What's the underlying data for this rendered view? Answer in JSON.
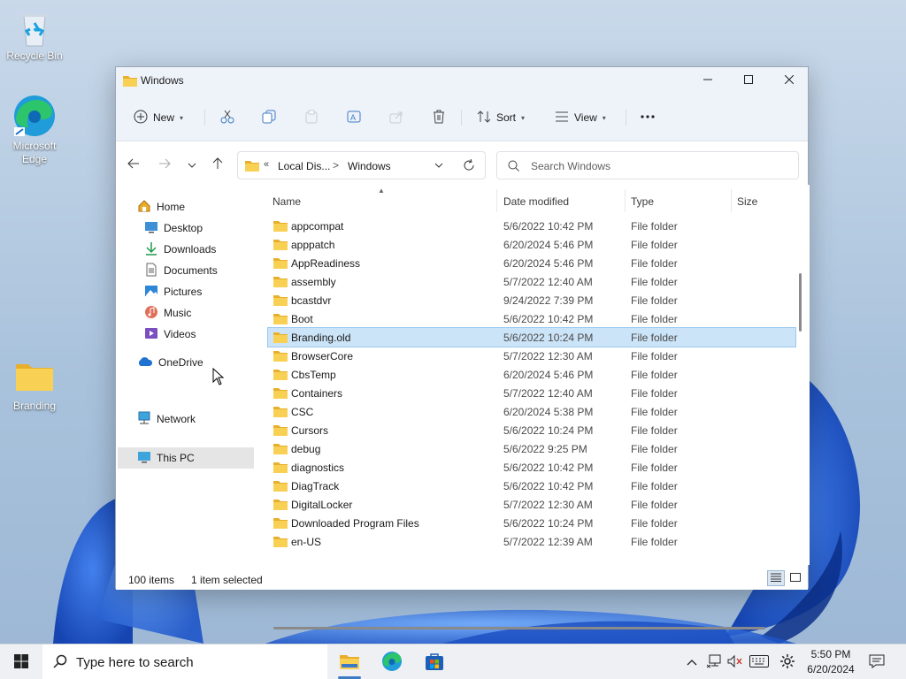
{
  "desktop": {
    "icons": [
      {
        "label": "Recycle Bin",
        "icon": "recycle-bin-icon"
      },
      {
        "label": "Microsoft\nEdge",
        "icon": "edge-icon"
      },
      {
        "label": "Branding",
        "icon": "folder-icon"
      }
    ]
  },
  "window": {
    "title": "Windows",
    "controls": {
      "minimize": "minimize-icon",
      "maximize": "maximize-icon",
      "close": "close-icon"
    }
  },
  "toolbar": {
    "new_label": "New",
    "sort_label": "Sort",
    "view_label": "View",
    "buttons": [
      "cut-icon",
      "copy-icon",
      "paste-icon",
      "rename-icon",
      "share-icon",
      "delete-icon",
      "more-icon"
    ]
  },
  "navigation": {
    "address": {
      "overflow": "«",
      "segment1": "Local Dis...",
      "separator": ">",
      "segment2": "Windows"
    },
    "search_placeholder": "Search Windows"
  },
  "sidebar": {
    "items": [
      {
        "label": "Home",
        "icon": "home-icon"
      },
      {
        "label": "Desktop",
        "icon": "desktop-icon",
        "pinned": true
      },
      {
        "label": "Downloads",
        "icon": "downloads-icon",
        "pinned": true
      },
      {
        "label": "Documents",
        "icon": "documents-icon",
        "pinned": true
      },
      {
        "label": "Pictures",
        "icon": "pictures-icon",
        "pinned": true
      },
      {
        "label": "Music",
        "icon": "music-icon"
      },
      {
        "label": "Videos",
        "icon": "videos-icon"
      },
      {
        "label": "OneDrive",
        "icon": "onedrive-icon"
      },
      {
        "label": "This PC",
        "icon": "this-pc-icon",
        "selected": true
      },
      {
        "label": "Network",
        "icon": "network-icon"
      }
    ]
  },
  "filelist": {
    "columns": {
      "name": "Name",
      "date": "Date modified",
      "type": "Type",
      "size": "Size"
    },
    "rows": [
      {
        "name": "appcompat",
        "date": "5/6/2022 10:42 PM",
        "type": "File folder"
      },
      {
        "name": "apppatch",
        "date": "6/20/2024 5:46 PM",
        "type": "File folder"
      },
      {
        "name": "AppReadiness",
        "date": "6/20/2024 5:46 PM",
        "type": "File folder"
      },
      {
        "name": "assembly",
        "date": "5/7/2022 12:40 AM",
        "type": "File folder"
      },
      {
        "name": "bcastdvr",
        "date": "9/24/2022 7:39 PM",
        "type": "File folder"
      },
      {
        "name": "Boot",
        "date": "5/6/2022 10:42 PM",
        "type": "File folder"
      },
      {
        "name": "Branding.old",
        "date": "5/6/2022 10:24 PM",
        "type": "File folder",
        "selected": true
      },
      {
        "name": "BrowserCore",
        "date": "5/7/2022 12:30 AM",
        "type": "File folder"
      },
      {
        "name": "CbsTemp",
        "date": "6/20/2024 5:46 PM",
        "type": "File folder"
      },
      {
        "name": "Containers",
        "date": "5/7/2022 12:40 AM",
        "type": "File folder"
      },
      {
        "name": "CSC",
        "date": "6/20/2024 5:38 PM",
        "type": "File folder"
      },
      {
        "name": "Cursors",
        "date": "5/6/2022 10:24 PM",
        "type": "File folder"
      },
      {
        "name": "debug",
        "date": "5/6/2022 9:25 PM",
        "type": "File folder"
      },
      {
        "name": "diagnostics",
        "date": "5/6/2022 10:42 PM",
        "type": "File folder"
      },
      {
        "name": "DiagTrack",
        "date": "5/6/2022 10:42 PM",
        "type": "File folder"
      },
      {
        "name": "DigitalLocker",
        "date": "5/7/2022 12:30 AM",
        "type": "File folder"
      },
      {
        "name": "Downloaded Program Files",
        "date": "5/6/2022 10:24 PM",
        "type": "File folder"
      },
      {
        "name": "en-US",
        "date": "5/7/2022 12:39 AM",
        "type": "File folder"
      }
    ]
  },
  "statusbar": {
    "item_count": "100 items",
    "selection": "1 item selected"
  },
  "taskbar": {
    "search_text": "Type here to search",
    "time": "5:50 PM",
    "date": "6/20/2024"
  },
  "colors": {
    "accent": "#0067c0",
    "folder": "#f8c43c",
    "selection": "#cce4f7"
  }
}
